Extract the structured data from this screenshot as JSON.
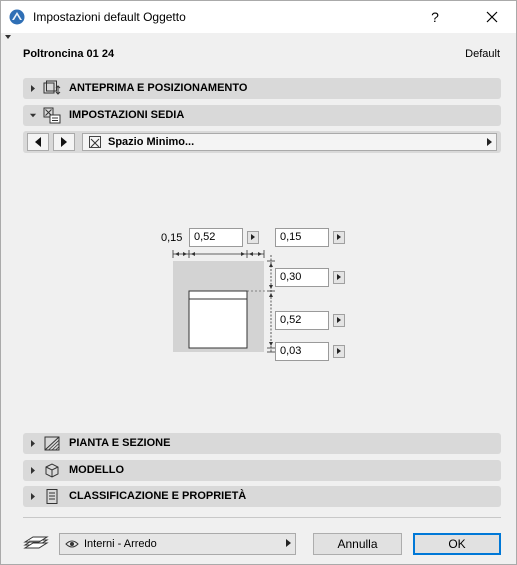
{
  "window": {
    "title": "Impostazioni default Oggetto",
    "help": "?",
    "close": "close"
  },
  "header": {
    "object_name": "Poltroncina 01 24",
    "default_label": "Default"
  },
  "panels": {
    "preview": {
      "label": "ANTEPRIMA E POSIZIONAMENTO",
      "icon": "preview-position-icon",
      "state": "collapsed"
    },
    "chair": {
      "label": "IMPOSTAZIONI SEDIA",
      "icon": "chair-settings-icon",
      "state": "expanded"
    },
    "plan": {
      "label": "PIANTA E SEZIONE",
      "icon": "plan-section-icon",
      "state": "collapsed"
    },
    "model": {
      "label": "MODELLO",
      "icon": "model-cube-icon",
      "state": "collapsed"
    },
    "classification": {
      "label": "CLASSIFICAZIONE E PROPRIETÀ",
      "icon": "document-list-icon",
      "state": "collapsed"
    }
  },
  "chair_settings": {
    "page_select": "Spazio Minimo...",
    "left_value": "0,15",
    "width_value": "0,52",
    "right_value": "0,15",
    "back_value": "0,30",
    "seat_depth_value": "0,52",
    "front_value": "0,03"
  },
  "footer": {
    "layer": "Interni - Arredo",
    "cancel_label": "Annulla",
    "ok_label": "OK"
  },
  "colors": {
    "panel_header": "#d9d9d9",
    "clearance_area": "#d3d3d3",
    "ok_border": "#0078d7",
    "app_icon": "#2f6fb5"
  }
}
